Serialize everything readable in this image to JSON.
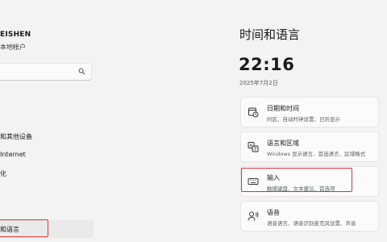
{
  "account": {
    "name": "EISHEN",
    "type": "本地帐户"
  },
  "search": {
    "placeholder": "",
    "icon": "search-icon"
  },
  "sidebar": {
    "items": [
      {
        "label": "和其他设备"
      },
      {
        "label": "Internet"
      },
      {
        "label": "化"
      },
      {
        "label": "和语言",
        "selected": true
      }
    ]
  },
  "main": {
    "title": "时间和语言",
    "clock": "22:16",
    "date": "2025年7月2日",
    "cards": [
      {
        "title": "日期和时间",
        "subtitle": "时区、自动时钟设置、日历显示",
        "icon": "clock-calendar-icon"
      },
      {
        "title": "语言和区域",
        "subtitle": "Windows 显示语言、首选语言、区域格式",
        "icon": "language-icon"
      },
      {
        "title": "输入",
        "subtitle": "触摸键盘、文本建议、首选项",
        "icon": "keyboard-icon",
        "highlighted": true
      },
      {
        "title": "语音",
        "subtitle": "语音语言、语音识别麦克风设置、声音",
        "icon": "speech-icon"
      }
    ]
  },
  "colors": {
    "highlight": "#e0323a",
    "background": "#f3f3f3",
    "card": "#fbfbfb"
  }
}
